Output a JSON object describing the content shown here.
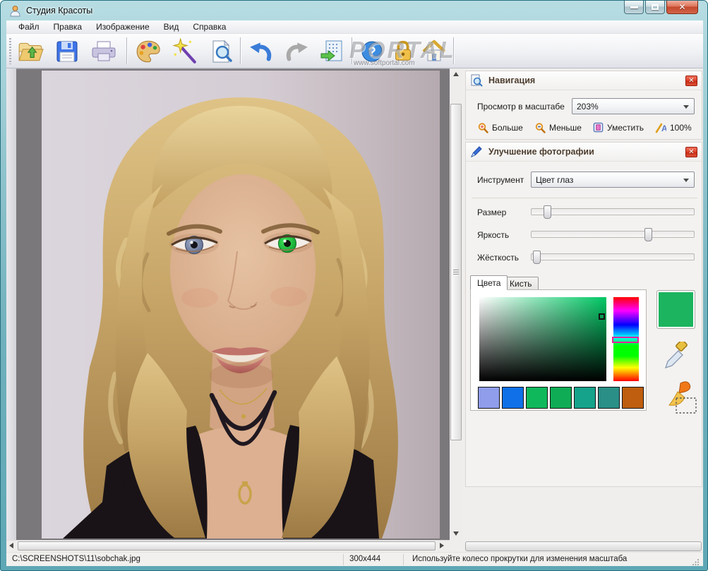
{
  "window": {
    "title": "Студия Красоты"
  },
  "menu": {
    "items": [
      "Файл",
      "Правка",
      "Изображение",
      "Вид",
      "Справка"
    ]
  },
  "toolbar": {
    "icons": [
      "open-icon",
      "save-icon",
      "print-icon",
      "palette-icon",
      "magic-wand-icon",
      "preview-icon",
      "undo-icon",
      "redo-icon",
      "resize-icon",
      "help-icon",
      "license-icon",
      "home-icon"
    ]
  },
  "watermark": {
    "brand": "PORTAL",
    "url": "www.softportal.com"
  },
  "panels": {
    "navigation": {
      "title": "Навигация",
      "zoom_label": "Просмотр в масштабе",
      "zoom_value": "203%",
      "buttons": {
        "zoom_in": "Больше",
        "zoom_out": "Меньше",
        "fit": "Уместить",
        "actual": "100%"
      }
    },
    "enhance": {
      "title": "Улучшение фотографии",
      "tool_label": "Инструмент",
      "tool_value": "Цвет глаз",
      "sliders": {
        "size": {
          "label": "Размер",
          "pct": 8
        },
        "brightness": {
          "label": "Яркость",
          "pct": 73
        },
        "hardness": {
          "label": "Жёсткость",
          "pct": 1
        }
      },
      "tabs": {
        "colors": "Цвета",
        "brush": "Кисть"
      },
      "colors": {
        "current": "#1cb45f",
        "sv_marker": {
          "x_pct": 97,
          "y_pct": 23
        },
        "hue_marker_pct": 50,
        "swatches": [
          "#8f9deb",
          "#1070e8",
          "#10b85c",
          "#0fac55",
          "#16a38c",
          "#2a8f86",
          "#be5e0e"
        ]
      }
    }
  },
  "statusbar": {
    "file_path": "C:\\SCREENSHOTS\\11\\sobchak.jpg",
    "image_size": "300x444",
    "hint": "Используйте колесо прокрутки для изменения масштаба"
  }
}
